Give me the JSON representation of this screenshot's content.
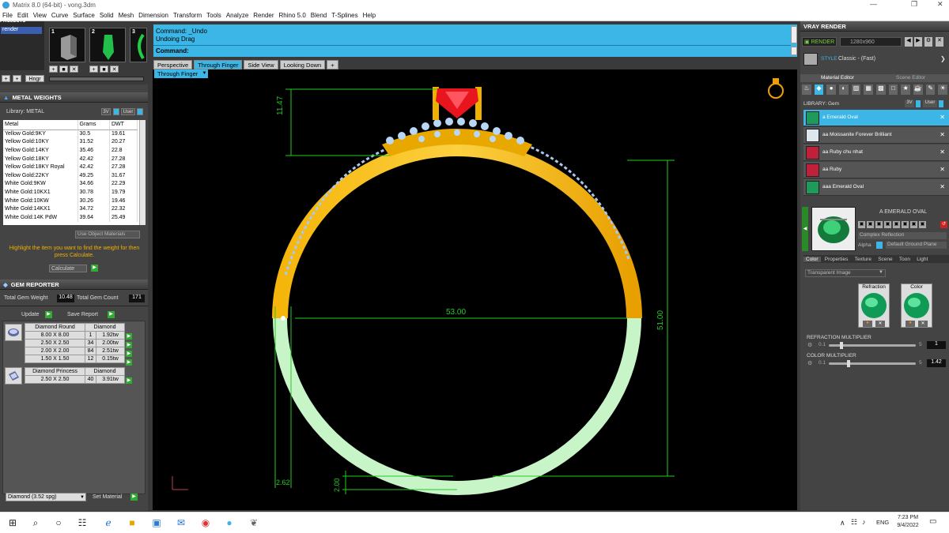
{
  "window": {
    "title": "Matrix 8.0 (64-bit) - vong.3dm"
  },
  "menu": [
    "File",
    "Edit",
    "View",
    "Curve",
    "Surface",
    "Solid",
    "Mesh",
    "Dimension",
    "Transform",
    "Tools",
    "Analyze",
    "Render",
    "Rhino 5.0",
    "Blend",
    "T-Splines",
    "Help"
  ],
  "projects": {
    "header": "PROJECTS",
    "item": "render",
    "thumbs": [
      "1",
      "2",
      "3"
    ],
    "hinge_label": "Hngr"
  },
  "metal_weights": {
    "header": "METAL WEIGHTS",
    "library_label": "Library: METAL",
    "toggle_3v": "3V",
    "toggle_user": "User",
    "columns": [
      "Metal",
      "Grams",
      "DWT"
    ],
    "rows": [
      [
        "Yellow Gold:9KY",
        "30.5",
        "19.61"
      ],
      [
        "Yellow Gold:10KY",
        "31.52",
        "20.27"
      ],
      [
        "Yellow Gold:14KY",
        "35.46",
        "22.8"
      ],
      [
        "Yellow Gold:18KY",
        "42.42",
        "27.28"
      ],
      [
        "Yellow Gold:18KY Royal",
        "42.42",
        "27.28"
      ],
      [
        "Yellow Gold:22KY",
        "49.25",
        "31.67"
      ],
      [
        "White Gold:9KW",
        "34.66",
        "22.29"
      ],
      [
        "White Gold:10KX1",
        "30.78",
        "19.79"
      ],
      [
        "White Gold:10KW",
        "30.26",
        "19.46"
      ],
      [
        "White Gold:14KX1",
        "34.72",
        "22.32"
      ],
      [
        "White Gold:14K PdW",
        "39.64",
        "25.49"
      ]
    ],
    "use_object_materials": "Use Object Materials",
    "hint": "Highlight the item you want to find the weight for then press Calculate.",
    "calculate": "Calculate"
  },
  "gem_reporter": {
    "header": "GEM REPORTER",
    "total_weight_label": "Total Gem Weight",
    "total_weight": "10.48",
    "total_count_label": "Total Gem Count",
    "total_count": "171",
    "update": "Update",
    "save_report": "Save Report",
    "groups": [
      {
        "name": "Diamond Round",
        "type": "Diamond",
        "rows": [
          [
            "8.00 X 8.00",
            "1",
            "1.92tw"
          ],
          [
            "2.50 X 2.50",
            "34",
            "2.00tw"
          ],
          [
            "2.00 X 2.00",
            "84",
            "2.51tw"
          ],
          [
            "1.50 X 1.50",
            "12",
            "0.15tw"
          ]
        ]
      },
      {
        "name": "Diamond Princess",
        "type": "Diamond",
        "rows": [
          [
            "2.50 X 2.50",
            "40",
            "3.91tw"
          ]
        ]
      }
    ],
    "material_select": "Diamond   (3.52 spg)",
    "set_material": "Set Material"
  },
  "command": {
    "line1": "Command: _Undo",
    "line2": "Undoing Drag",
    "prompt": "Command:"
  },
  "view_tabs": [
    "Perspective",
    "Through Finger",
    "Side View",
    "Looking Down",
    "+"
  ],
  "active_tab": "Through Finger",
  "viewport_label": "Through Finger",
  "dimensions": {
    "top_height": "11.47",
    "width": "53.00",
    "height": "51.00",
    "band_width": "2.62",
    "band_thickness": "2.00"
  },
  "vray": {
    "header": "VRAY RENDER",
    "render_btn": "RENDER",
    "resolution": "1280x960",
    "style_label": "STYLE",
    "style_value": "Classic - (Fast)",
    "tabs": [
      "Material Editor",
      "Scene Editor"
    ],
    "library_label": "LIBRARY: Gem",
    "toggle_3v": "3V",
    "toggle_user": "User",
    "materials": [
      {
        "name": "a Emerald Oval",
        "color": "#1e9a5a",
        "selected": true
      },
      {
        "name": "aa Moissanite Forever Brilliant",
        "color": "#dfe7ee",
        "selected": false
      },
      {
        "name": "aa Ruby chu nhat",
        "color": "#c0203a",
        "selected": false
      },
      {
        "name": "aa Ruby",
        "color": "#c0203a",
        "selected": false
      },
      {
        "name": "aaa Emerald Oval",
        "color": "#1e9a5a",
        "selected": false
      }
    ],
    "preview_title": "A EMERALD OVAL",
    "complex_reflection": "Complex Reflection",
    "alpha_label": "Alpha",
    "ground": "Default Ground Plane",
    "subtabs": [
      "Color",
      "Properties",
      "Texture",
      "Scene",
      "Toon",
      "Light"
    ],
    "transparent_label": "Transparent Image",
    "refraction_label": "Refraction",
    "color_label": "Color",
    "refraction_multiplier": {
      "label": "REFRACTION MULTIPLIER",
      "min": "0.1",
      "max": "5",
      "value": "1"
    },
    "color_multiplier": {
      "label": "COLOR MULTIPLIER",
      "min": "0.1",
      "max": "5",
      "value": "1.42"
    }
  },
  "taskbar": {
    "time": "7:23 PM",
    "date": "9/4/2022",
    "lang": "ENG"
  }
}
